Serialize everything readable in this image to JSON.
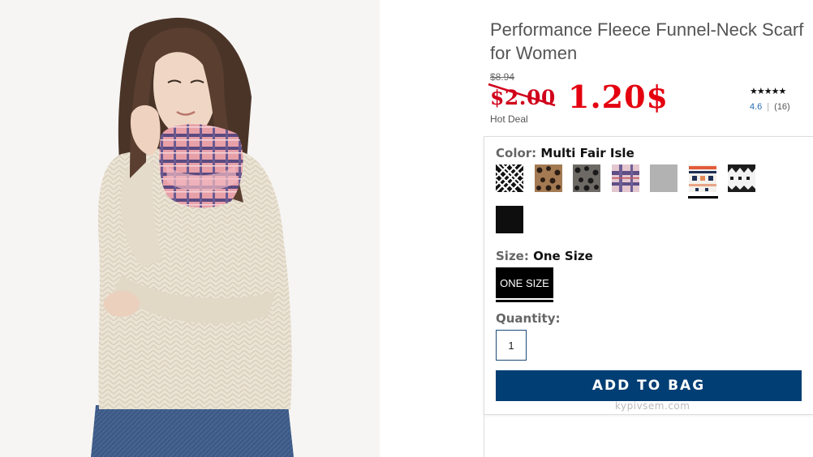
{
  "product": {
    "title": "Performance Fleece Funnel-Neck Scarf for Women",
    "original_price": "$8.94",
    "sale_price": "$2.00",
    "handwritten_price": "1.20$",
    "deal_label": "Hot Deal",
    "rating": {
      "stars": "★★★★★",
      "value": "4.6",
      "count": "(16)"
    }
  },
  "color": {
    "label": "Color:",
    "selected": "Multi Fair Isle",
    "swatches": [
      "black-white-grid",
      "leopard-tan",
      "leopard-gray",
      "plaid-purple",
      "heather-gray",
      "multi-fair-isle",
      "black-white-fair-isle",
      "solid-black"
    ]
  },
  "size": {
    "label": "Size:",
    "selected": "One Size",
    "options": [
      "ONE SIZE"
    ]
  },
  "quantity": {
    "label": "Quantity:",
    "value": "1"
  },
  "cta": {
    "add_to_bag": "ADD TO BAG"
  },
  "watermark": "kypivsem.com",
  "colors": {
    "accent": "#003e74",
    "price_red": "#d0021b",
    "handwritten_red": "#e4000f",
    "rating_blue": "#2a6db0"
  }
}
